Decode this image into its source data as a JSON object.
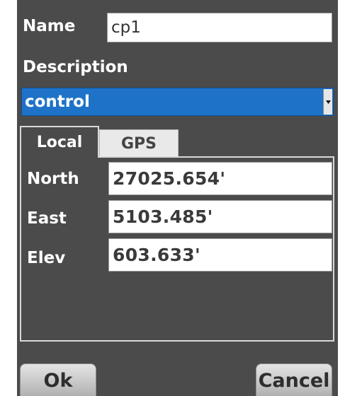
{
  "dialog": {
    "name_label": "Name",
    "name_value": "cp1",
    "description_label": "Description",
    "description_value": "control",
    "tabs": [
      {
        "label": "Local",
        "active": true
      },
      {
        "label": "GPS",
        "active": false
      }
    ],
    "local": {
      "north_label": "North",
      "north_value": "27025.654'",
      "east_label": "East",
      "east_value": "5103.485'",
      "elev_label": "Elev",
      "elev_value": "603.633'"
    },
    "buttons": {
      "ok_label": "Ok",
      "cancel_label": "Cancel"
    }
  },
  "colors": {
    "dialog_bg": "#4b4b4b",
    "select_bg": "#1e73c9",
    "label_text": "#ffffff"
  }
}
